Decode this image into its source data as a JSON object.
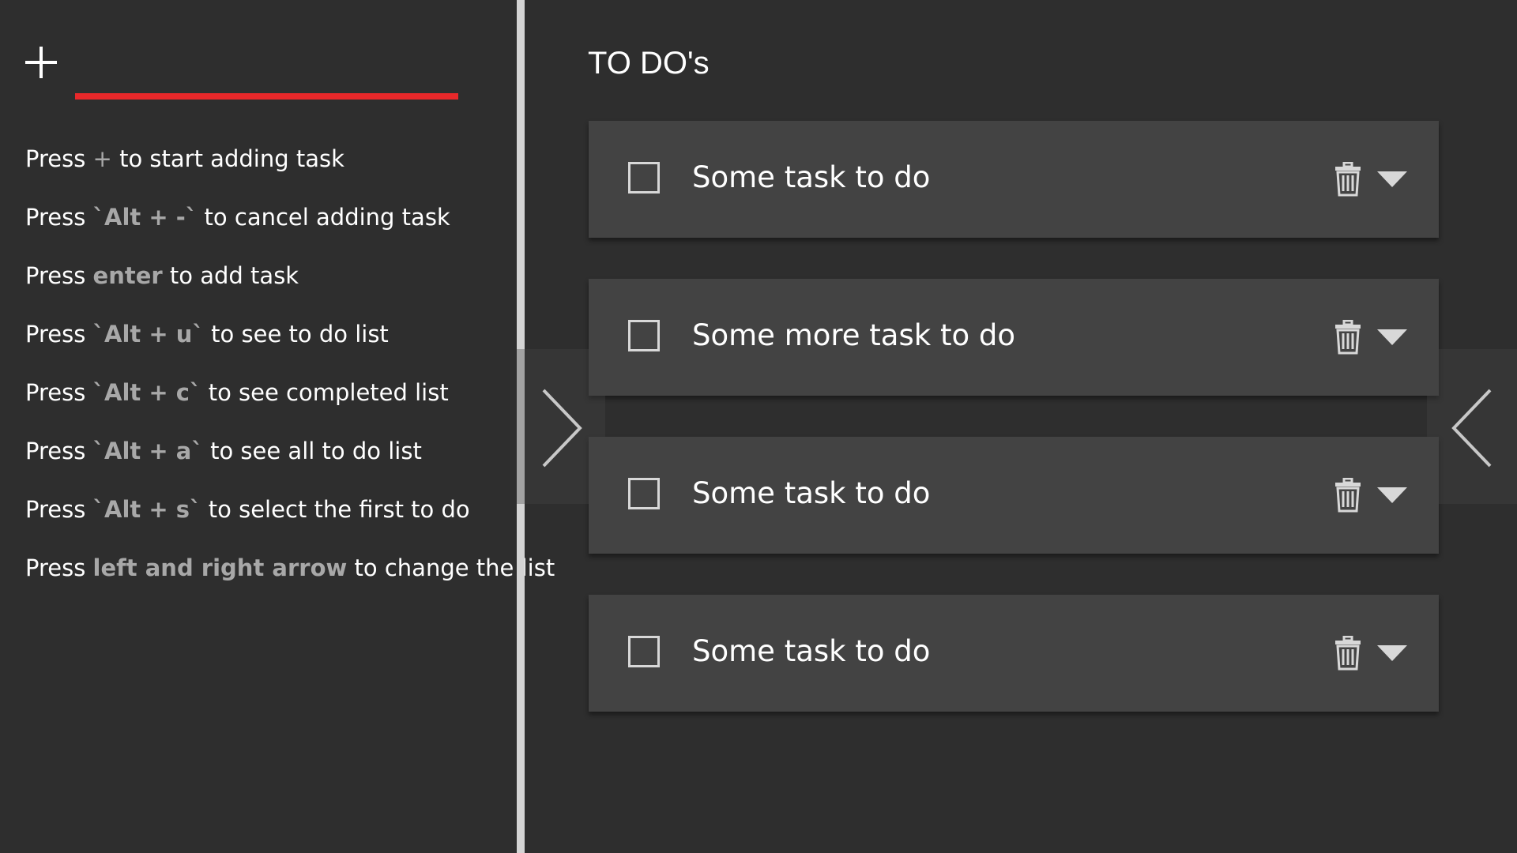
{
  "sidebar": {
    "add_icon": "plus-icon",
    "input_value": "",
    "input_placeholder": "",
    "accent_color": "#e8282a",
    "help": [
      {
        "pre": "Press ",
        "key": "+",
        "post": " to start adding task"
      },
      {
        "pre": "Press ",
        "key": "`Alt + -`",
        "post": " to cancel adding task"
      },
      {
        "pre": "Press ",
        "key": "enter",
        "post": " to add task"
      },
      {
        "pre": "Press ",
        "key": "`Alt + u`",
        "post": " to see to do list"
      },
      {
        "pre": "Press ",
        "key": "`Alt + c`",
        "post": " to see completed list"
      },
      {
        "pre": "Press ",
        "key": "`Alt + a`",
        "post": " to see all to do list"
      },
      {
        "pre": "Press ",
        "key": "`Alt + s`",
        "post": " to select the first to do"
      },
      {
        "pre": "Press ",
        "key": "left and right arrow",
        "post": " to change the list"
      }
    ]
  },
  "main": {
    "title": "TO DO's",
    "tasks": [
      {
        "text": "Some task to do",
        "checked": false
      },
      {
        "text": "Some more task to do",
        "checked": false
      },
      {
        "text": "Some task to do",
        "checked": false
      },
      {
        "text": "Some task to do",
        "checked": false
      }
    ]
  },
  "nav": {
    "prev_icon": "chevron-right-icon",
    "next_icon": "chevron-left-icon"
  }
}
